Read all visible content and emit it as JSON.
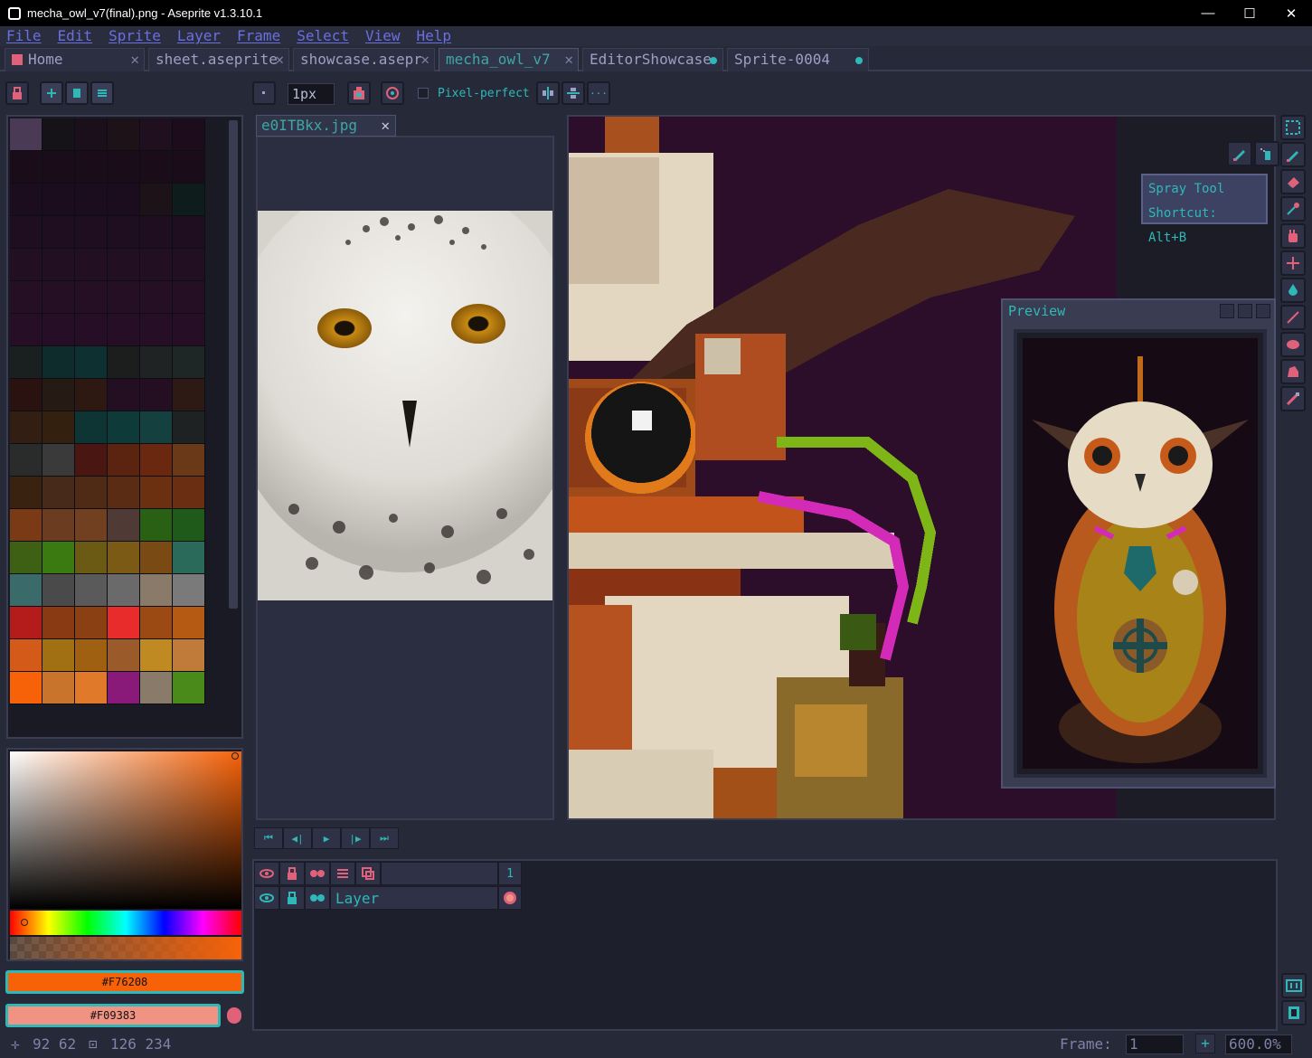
{
  "window": {
    "title": "mecha_owl_v7(final).png - Aseprite v1.3.10.1",
    "minimize": "—",
    "maximize": "☐",
    "close": "✕"
  },
  "menu": [
    "File",
    "Edit",
    "Sprite",
    "Layer",
    "Frame",
    "Select",
    "View",
    "Help"
  ],
  "tabs": [
    {
      "label": "Home",
      "mark": "✕"
    },
    {
      "label": "sheet.aseprite",
      "mark": "✕"
    },
    {
      "label": "showcase.asepr",
      "mark": "✕"
    },
    {
      "label": "mecha_owl_v7",
      "mark": "✕"
    },
    {
      "label": "EditorShowcase",
      "mark": "dot"
    },
    {
      "label": "Sprite-0004",
      "mark": "dot"
    }
  ],
  "toolbar": {
    "brush_size": "1px",
    "pixel_perfect": "Pixel-perfect",
    "more": "···"
  },
  "reference": {
    "tab_label": "e0ITBkx.jpg",
    "close": "✕"
  },
  "tooltip": {
    "line1": "Spray Tool",
    "line2": "Shortcut: Alt+B"
  },
  "preview": {
    "title": "Preview"
  },
  "colors": {
    "foreground_hex": "#F76208",
    "background_hex": "#F09383",
    "foreground": "#F76208",
    "background": "#F09383"
  },
  "palette": [
    "#4a3a56",
    "#151318",
    "#1c0f1c",
    "#1c1217",
    "#200f1f",
    "#1c0c1c",
    "#1a0c19",
    "#1a0c19",
    "#1a0c19",
    "#1a0c19",
    "#1a0c19",
    "#1a0c19",
    "#1c0d1e",
    "#1c0d1e",
    "#1c0d1e",
    "#1c0d1e",
    "#1c1218",
    "#0f1c1c",
    "#1e0e20",
    "#1e0e20",
    "#1e0e20",
    "#1e0e20",
    "#1e0e20",
    "#1e0e20",
    "#220f22",
    "#220f22",
    "#220f22",
    "#220f22",
    "#220f22",
    "#220f22",
    "#240f24",
    "#240f24",
    "#240f24",
    "#240f24",
    "#240f24",
    "#240f24",
    "#260f26",
    "#260f26",
    "#260f26",
    "#260f26",
    "#260f26",
    "#260f26",
    "#1a1f1f",
    "#0f2c2c",
    "#0f3030",
    "#1c1e1e",
    "#1f2323",
    "#1f2626",
    "#2a1210",
    "#251a14",
    "#2e1812",
    "#230e22",
    "#230e22",
    "#2e1a14",
    "#321e12",
    "#33200f",
    "#0f3434",
    "#0f3a3a",
    "#154040",
    "#1e2222",
    "#2a2c2c",
    "#3a3a3a",
    "#4a1612",
    "#5a2410",
    "#6a2810",
    "#6a3a18",
    "#3a2210",
    "#482a1a",
    "#4f2a14",
    "#5a2c14",
    "#6a3010",
    "#6a2e12",
    "#7a3a16",
    "#6c3c20",
    "#704020",
    "#503a36",
    "#2a6014",
    "#1f5a1a",
    "#3e6014",
    "#3a7a10",
    "#6a5a14",
    "#7a5a14",
    "#7a4a14",
    "#2a6a5a",
    "#3a6a6a",
    "#4a4a4a",
    "#5a5a5a",
    "#6a6a6a",
    "#8a7a6a",
    "#7a7a7a",
    "#b41c1c",
    "#8a3a12",
    "#8a4012",
    "#e82c2c",
    "#9a4a12",
    "#b45a12",
    "#d45a1a",
    "#a07012",
    "#a06012",
    "#9a5a2a",
    "#c08a22",
    "#c07a3a",
    "#f76208",
    "#c8742c",
    "#e07a2a",
    "#8a1a7a",
    "#8a7a6a",
    "#4a8a1a"
  ],
  "animation_controls": [
    "⏮",
    "◀|",
    "▶",
    "|▶",
    "⏭"
  ],
  "timeline": {
    "frame_number": "1",
    "layer_name": "Layer"
  },
  "statusbar": {
    "cursor_pos": "92 62",
    "selection_size": "126 234",
    "frame_label": "Frame:",
    "frame_value": "1",
    "add_frame": "+",
    "zoom": "600.0%"
  }
}
